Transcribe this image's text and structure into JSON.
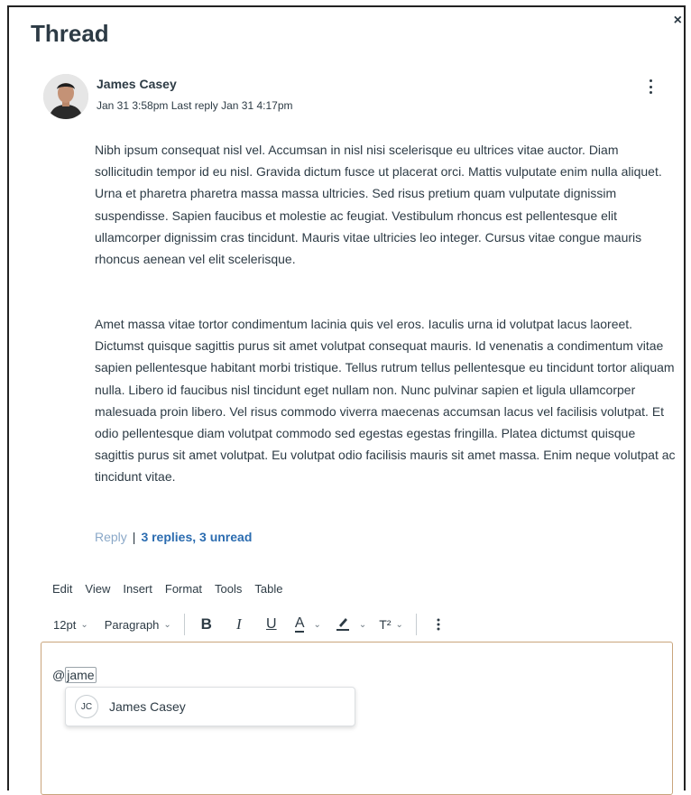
{
  "thread": {
    "title": "Thread",
    "close_label": "×"
  },
  "post": {
    "author": "James Casey",
    "posted": "Jan 31 3:58pm",
    "last_reply": "Last reply Jan 31 4:17pm",
    "paragraphs": [
      "Nibh ipsum consequat nisl vel. Accumsan in nisl nisi scelerisque eu ultrices vitae auctor. Diam sollicitudin tempor id eu nisl. Gravida dictum fusce ut placerat orci. Mattis vulputate enim nulla aliquet. Urna et pharetra pharetra massa massa ultricies. Sed risus pretium quam vulputate dignissim suspendisse. Sapien faucibus et molestie ac feugiat. Vestibulum rhoncus est pellentesque elit ullamcorper dignissim cras tincidunt. Mauris vitae ultricies leo integer. Cursus vitae congue mauris rhoncus aenean vel elit scelerisque.",
      "Amet massa vitae tortor condimentum lacinia quis vel eros. Iaculis urna id volutpat lacus laoreet. Dictumst quisque sagittis purus sit amet volutpat consequat mauris. Id venenatis a condimentum vitae sapien pellentesque habitant morbi tristique. Tellus rutrum tellus pellentesque eu tincidunt tortor aliquam nulla. Libero id faucibus nisl tincidunt eget nullam non. Nunc pulvinar sapien et ligula ullamcorper malesuada proin libero. Vel risus commodo viverra maecenas accumsan lacus vel facilisis volutpat. Et odio pellentesque diam volutpat commodo sed egestas egestas fringilla. Platea dictumst quisque sagittis purus sit amet volutpat. Eu volutpat odio facilisis mauris sit amet massa. Enim neque volutpat ac tincidunt vitae."
    ],
    "reply_label": "Reply",
    "separator": "|",
    "replies_label": "3 replies, 3 unread"
  },
  "editor": {
    "menu": [
      "Edit",
      "View",
      "Insert",
      "Format",
      "Tools",
      "Table"
    ],
    "font_size": "12pt",
    "block_format": "Paragraph",
    "bold": "B",
    "italic": "I",
    "underline": "U",
    "font_color": "A",
    "superscript": "T²",
    "typed_prefix": "@",
    "typed_query": "jame",
    "mention_suggestion": {
      "initials": "JC",
      "name": "James Casey"
    }
  },
  "colors": {
    "text": "#2d3b45",
    "link": "#2b6cb0",
    "reply_link": "#8aa8c8",
    "editor_border": "#c9a57c"
  }
}
